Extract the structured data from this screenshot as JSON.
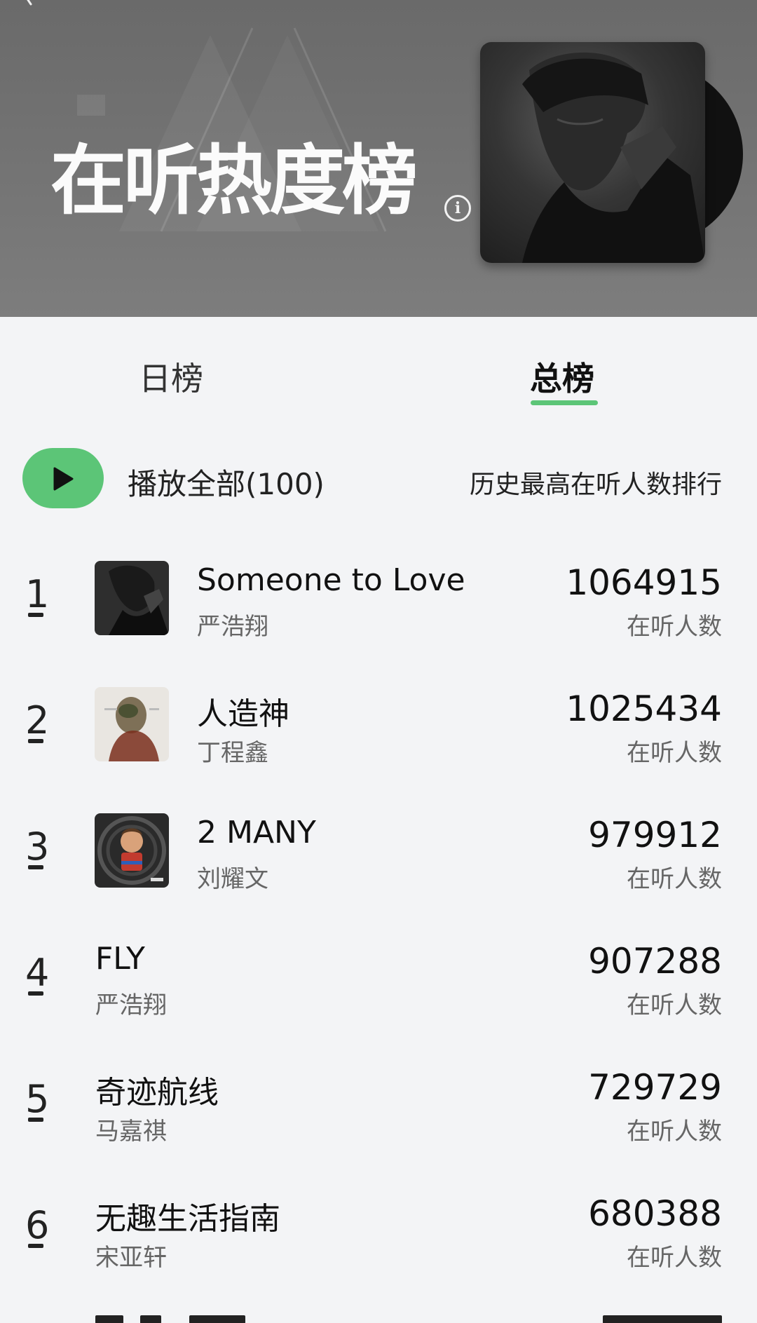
{
  "header": {
    "title": "在听热度榜"
  },
  "tabs": [
    {
      "label": "日榜",
      "active": false
    },
    {
      "label": "总榜",
      "active": true
    }
  ],
  "accent_color": "#5cc577",
  "toolbar": {
    "play_all_label": "播放全部(100)",
    "sort_label": "历史最高在听人数排行"
  },
  "songs": [
    {
      "rank": "1",
      "title": "Someone to Love",
      "artist": "严浩翔",
      "count": "1064915",
      "count_label": "在听人数"
    },
    {
      "rank": "2",
      "title": "人造神",
      "artist": "丁程鑫",
      "count": "1025434",
      "count_label": "在听人数"
    },
    {
      "rank": "3",
      "title": "2 MANY",
      "artist": "刘耀文",
      "count": "979912",
      "count_label": "在听人数"
    },
    {
      "rank": "4",
      "title": "FLY",
      "artist": "严浩翔",
      "count": "907288",
      "count_label": "在听人数"
    },
    {
      "rank": "5",
      "title": "奇迹航线",
      "artist": "马嘉祺",
      "count": "729729",
      "count_label": "在听人数"
    },
    {
      "rank": "6",
      "title": "无趣生活指南",
      "artist": "宋亚轩",
      "count": "680388",
      "count_label": "在听人数"
    }
  ]
}
